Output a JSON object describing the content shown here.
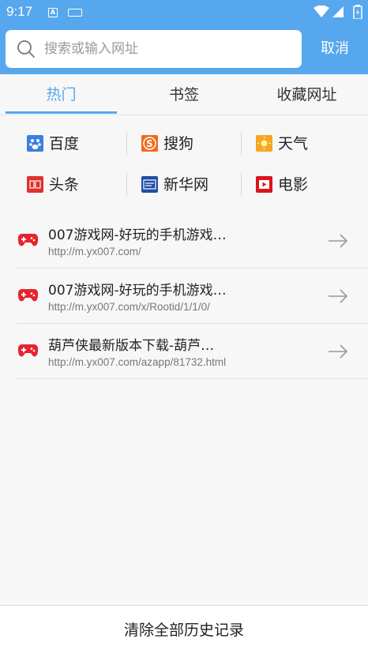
{
  "status_bar": {
    "time": "9:17",
    "sim_glyph": "A"
  },
  "search": {
    "placeholder": "搜索或输入网址",
    "value": "",
    "cancel_label": "取消"
  },
  "tabs": [
    {
      "label": "热门",
      "active": true
    },
    {
      "label": "书签",
      "active": false
    },
    {
      "label": "收藏网址",
      "active": false
    }
  ],
  "quick_links": [
    {
      "label": "百度",
      "icon": "baidu-icon",
      "color": "#3a7fe0"
    },
    {
      "label": "搜狗",
      "icon": "sogou-icon",
      "color": "#f06a1a"
    },
    {
      "label": "天气",
      "icon": "weather-icon",
      "color": "#f6a623"
    },
    {
      "label": "头条",
      "icon": "toutiao-icon",
      "color": "#e0312b"
    },
    {
      "label": "新华网",
      "icon": "xinhua-icon",
      "color": "#1f4fa8"
    },
    {
      "label": "电影",
      "icon": "movie-icon",
      "color": "#d8161b"
    }
  ],
  "history": [
    {
      "title": "007游戏网-好玩的手机游戏…",
      "url": "http://m.yx007.com/"
    },
    {
      "title": "007游戏网-好玩的手机游戏…",
      "url": "http://m.yx007.com/x/Rootid/1/1/0/"
    },
    {
      "title": "葫芦侠最新版本下载-葫芦…",
      "url": "http://m.yx007.com/azapp/81732.html"
    }
  ],
  "footer": {
    "clear_label": "清除全部历史记录"
  },
  "colors": {
    "accent": "#56a7ee",
    "game_icon": "#e8232f"
  }
}
